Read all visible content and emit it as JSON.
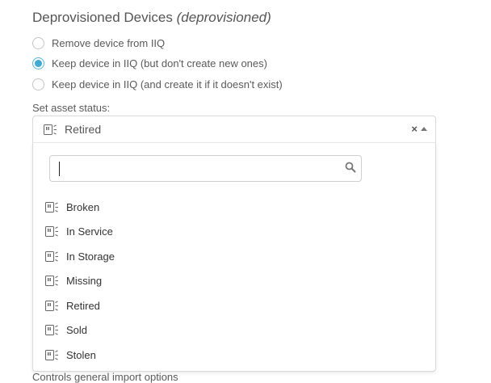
{
  "section": {
    "title": "Deprovisioned Devices",
    "title_key": "(deprovisioned)"
  },
  "radio_options": [
    {
      "label": "Remove device from IIQ",
      "checked": false
    },
    {
      "label": "Keep device in IIQ (but don't create new ones)",
      "checked": true
    },
    {
      "label": "Keep device in IIQ (and create it if it doesn't exist)",
      "checked": false
    }
  ],
  "asset_status": {
    "label": "Set asset status:",
    "selected": "Retired",
    "clear_icon": "close-icon",
    "toggle_icon": "caret-up-icon"
  },
  "dropdown": {
    "search_value": "",
    "search_icon": "search-icon",
    "options": [
      "Broken",
      "In Service",
      "In Storage",
      "Missing",
      "Retired",
      "Sold",
      "Stolen"
    ]
  },
  "footer": {
    "text": "Controls general import options"
  },
  "colors": {
    "radio_accent": "#42a9d3",
    "text": "#555555",
    "border": "#d9d9d9"
  }
}
